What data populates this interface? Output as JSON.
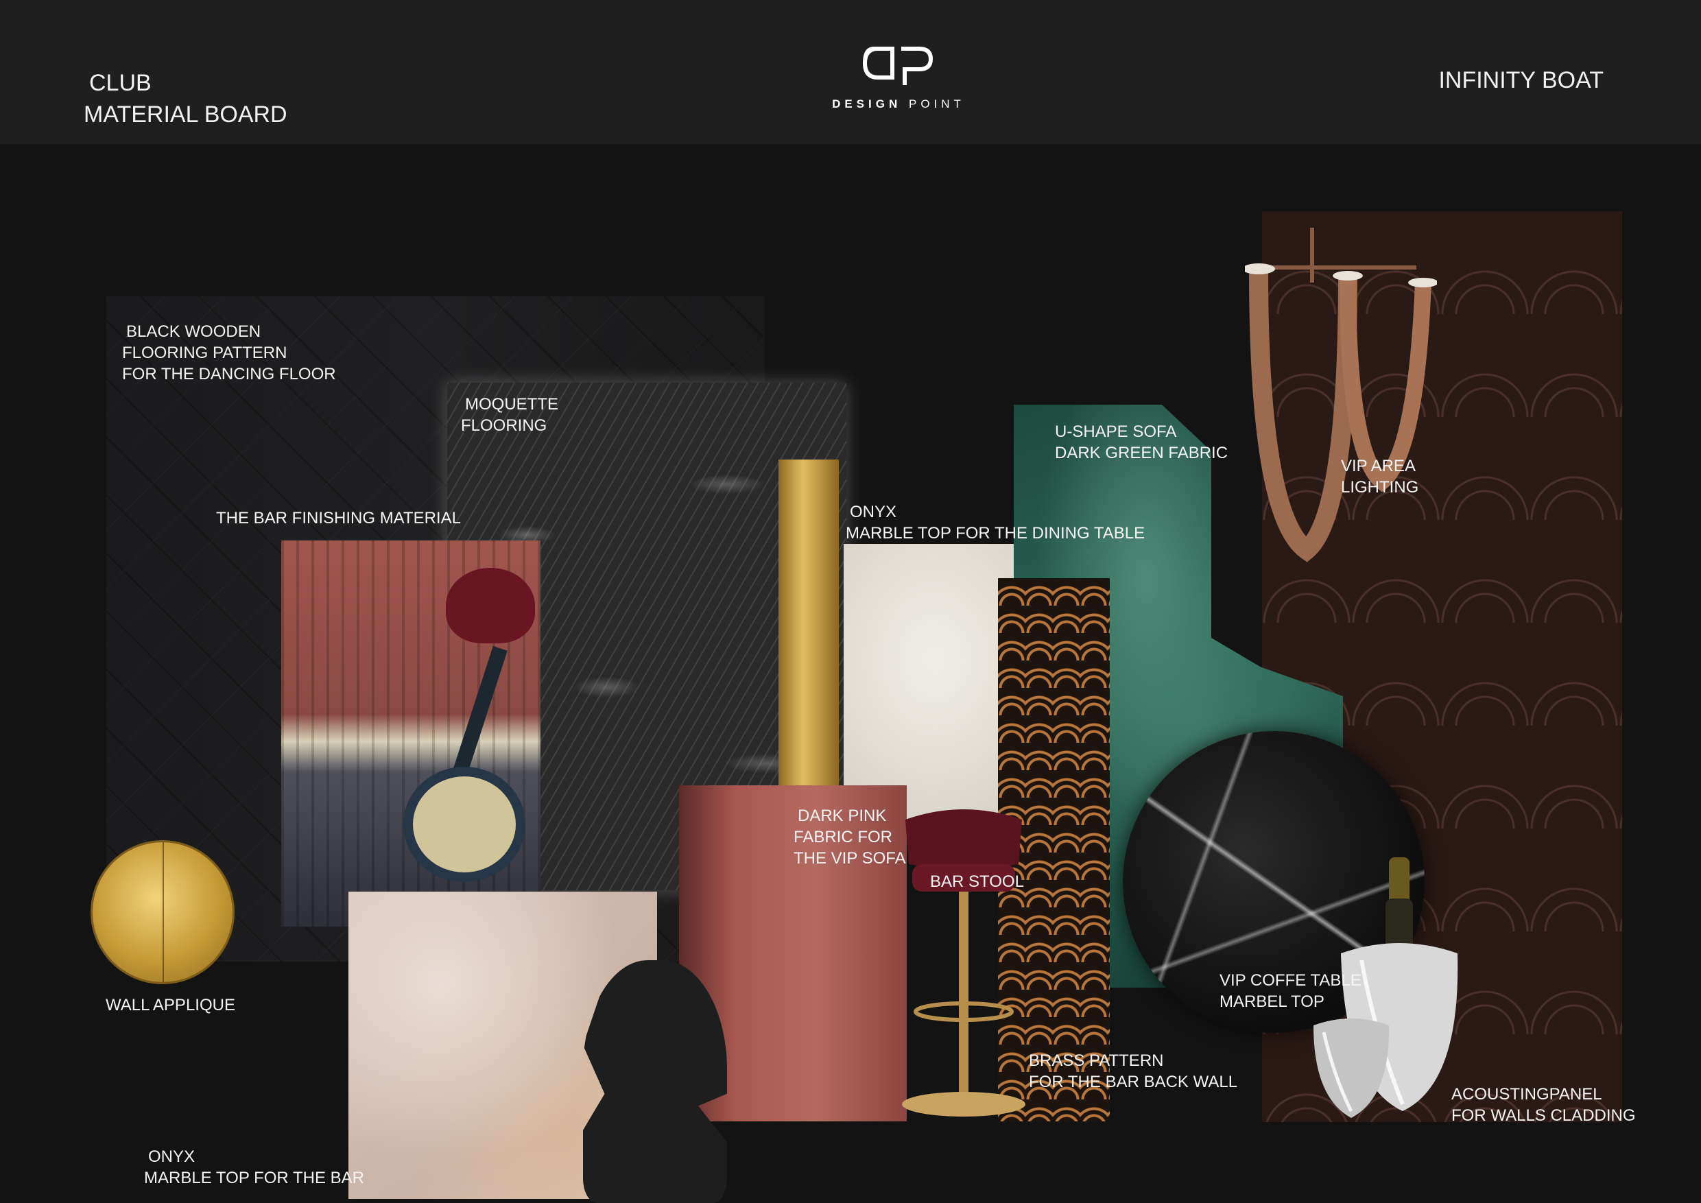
{
  "header": {
    "left_line1": "CLUB",
    "left_line2": "MATERIAL BOARD",
    "right": "INFINITY BOAT",
    "logo_word1": "DESIGN",
    "logo_word2": "POINT"
  },
  "labels": {
    "wood": [
      "BLACK WOODEN",
      "FLOORING PATTERN",
      "FOR THE DANCING FLOOR"
    ],
    "moquette": [
      "MOQUETTE",
      "FLOORING"
    ],
    "bar_finish": "THE BAR FINISHING MATERIAL",
    "onyx_dining": [
      "ONYX",
      "MARBLE TOP FOR THE DINING TABLE"
    ],
    "sofa": [
      "U-SHAPE SOFA",
      "DARK GREEN FABRIC"
    ],
    "lighting": [
      "VIP AREA",
      "LIGHTING"
    ],
    "dark_pink": [
      "DARK PINK",
      "FABRIC FOR",
      "THE VIP SOFA"
    ],
    "bar_stool": "BAR STOOL",
    "coffee_table": [
      "VIP COFFE TABLE",
      "MARBEL TOP"
    ],
    "brass": [
      "BRASS PATTERN",
      "FOR THE BAR BACK WALL"
    ],
    "acoustic": [
      "ACOUSTINGPANEL",
      "FOR WALLS CLADDING"
    ],
    "wall_applique": "WALL APPLIQUE",
    "onyx_bar": [
      "ONYX",
      "MARBLE TOP FOR THE BAR"
    ]
  },
  "colors": {
    "background": "#131314",
    "header": "#1f1f20",
    "gold": "#c9a24a",
    "sofa_green": "#2f6a5a",
    "dark_pink": "#a9584f"
  }
}
